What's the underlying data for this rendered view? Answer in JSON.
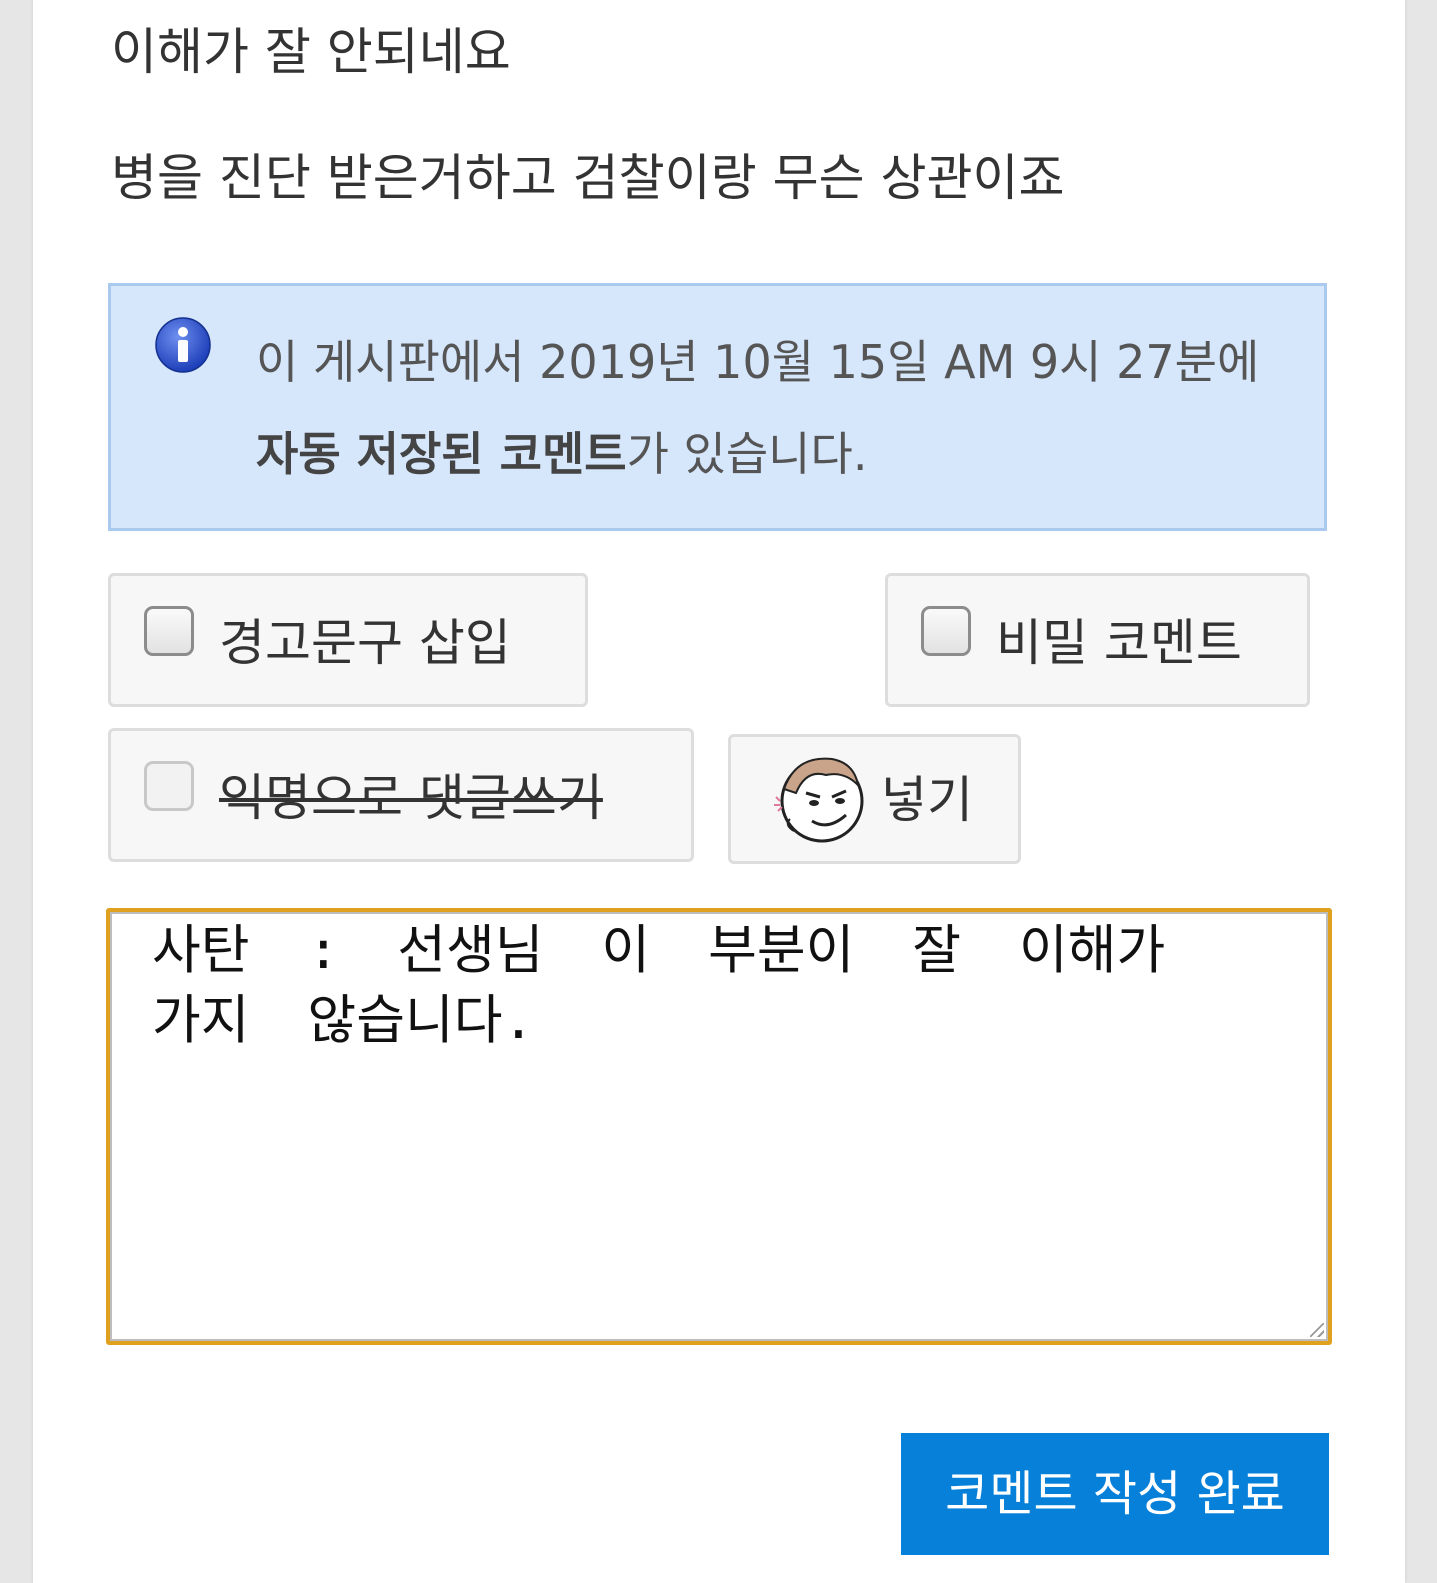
{
  "post": {
    "line1": "이해가 잘 안되네요",
    "line2": "병을 진단 받은거하고 검찰이랑 무슨 상관이죠"
  },
  "notice": {
    "icon": "info-icon",
    "text_before": "이 게시판에서 2019년 10월 15일 AM 9시 27분에 ",
    "text_bold": "자동 저장된 코멘트",
    "text_after": "가 있습니다."
  },
  "options": {
    "warning_label": "경고문구 삽입",
    "secret_label": "비밀 코멘트",
    "anonymous_label": "익명으로 댓글쓰기",
    "emoticon_label": "넣기"
  },
  "comment": {
    "value": "사탄 : 선생님 이 부분이 잘 이해가 가지 않습니다."
  },
  "submit": {
    "label": "코멘트 작성 완료"
  },
  "colors": {
    "notice_bg": "#d6e6fb",
    "focus_border": "#e0a020",
    "submit_bg": "#0780d9"
  }
}
